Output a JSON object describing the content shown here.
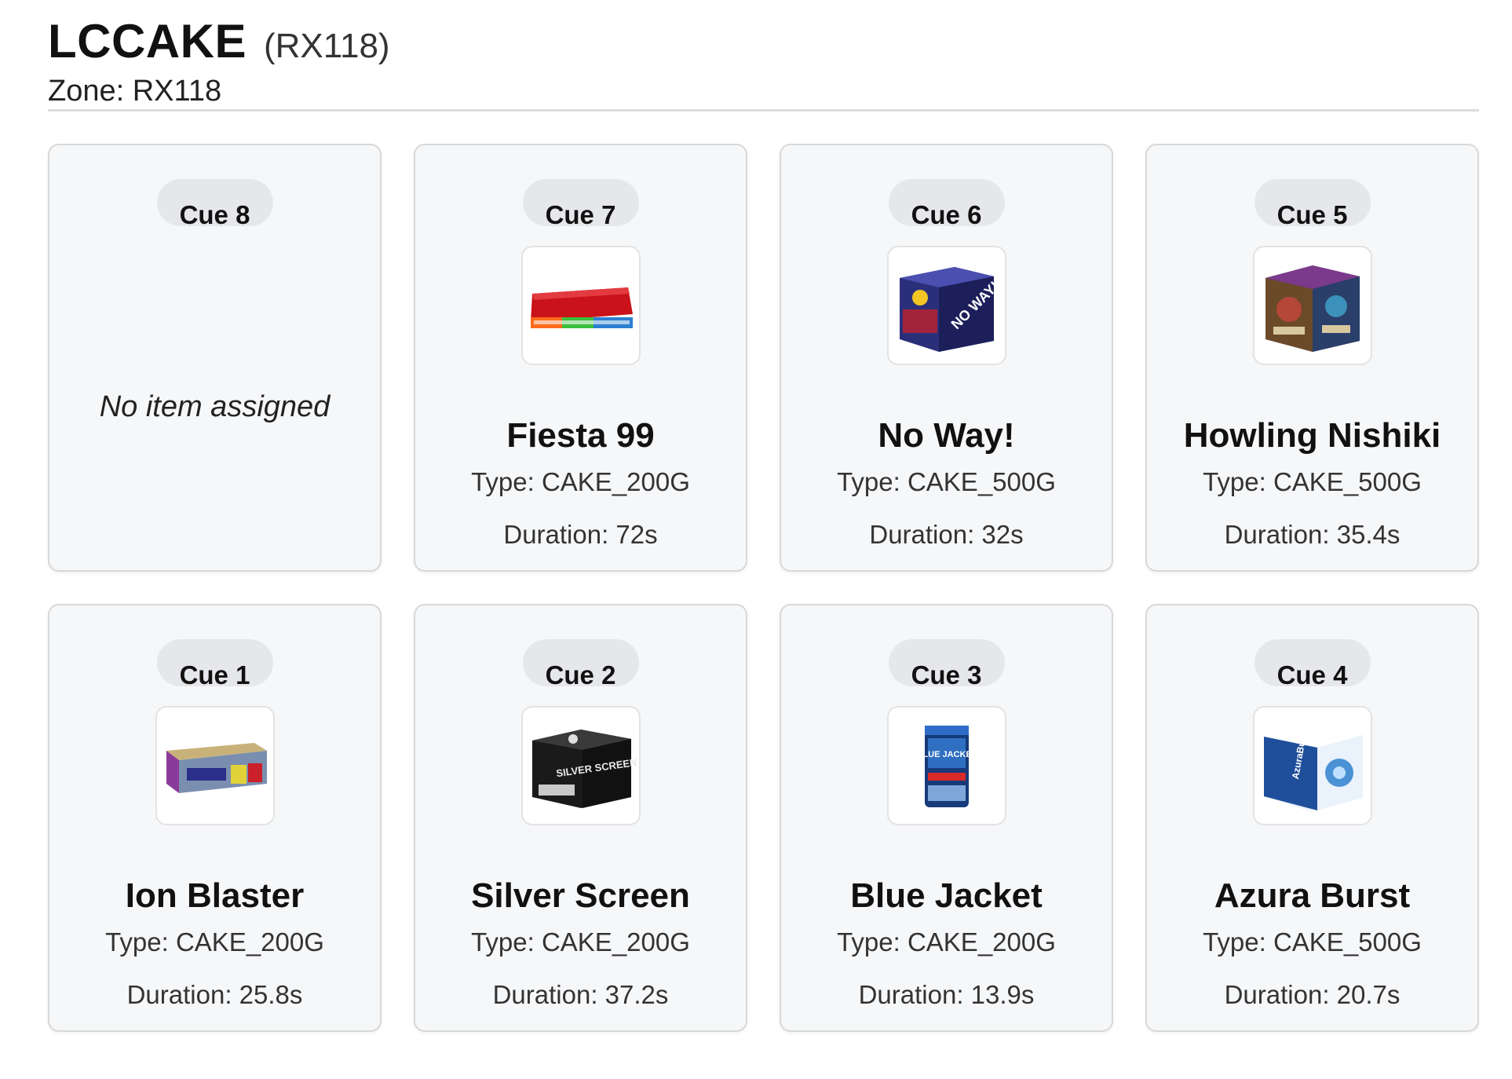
{
  "header": {
    "title": "LCCAKE",
    "subtitle": "(RX118)",
    "zone": "Zone: RX118"
  },
  "cards": [
    {
      "cue": "Cue 8",
      "empty_text": "No item assigned"
    },
    {
      "cue": "Cue 7",
      "name": "Fiesta 99",
      "type": "Type: CAKE_200G",
      "duration": "Duration: 72s",
      "thumb_icon": "fiesta-99-product-image"
    },
    {
      "cue": "Cue 6",
      "name": "No Way!",
      "type": "Type: CAKE_500G",
      "duration": "Duration: 32s",
      "thumb_icon": "no-way-product-image",
      "thumb_text": "NO WAY!"
    },
    {
      "cue": "Cue 5",
      "name": "Howling Nishiki",
      "type": "Type: CAKE_500G",
      "duration": "Duration: 35.4s",
      "thumb_icon": "howling-nishiki-product-image"
    },
    {
      "cue": "Cue 1",
      "name": "Ion Blaster",
      "type": "Type: CAKE_200G",
      "duration": "Duration: 25.8s",
      "thumb_icon": "ion-blaster-product-image"
    },
    {
      "cue": "Cue 2",
      "name": "Silver Screen",
      "type": "Type: CAKE_200G",
      "duration": "Duration: 37.2s",
      "thumb_icon": "silver-screen-product-image",
      "thumb_text": "SILVER SCREEN"
    },
    {
      "cue": "Cue 3",
      "name": "Blue Jacket",
      "type": "Type: CAKE_200G",
      "duration": "Duration: 13.9s",
      "thumb_icon": "blue-jacket-product-image",
      "thumb_text": "BLUE JACKET"
    },
    {
      "cue": "Cue 4",
      "name": "Azura Burst",
      "type": "Type: CAKE_500G",
      "duration": "Duration: 20.7s",
      "thumb_icon": "azura-burst-product-image",
      "thumb_text": "AzuraBurst"
    }
  ]
}
